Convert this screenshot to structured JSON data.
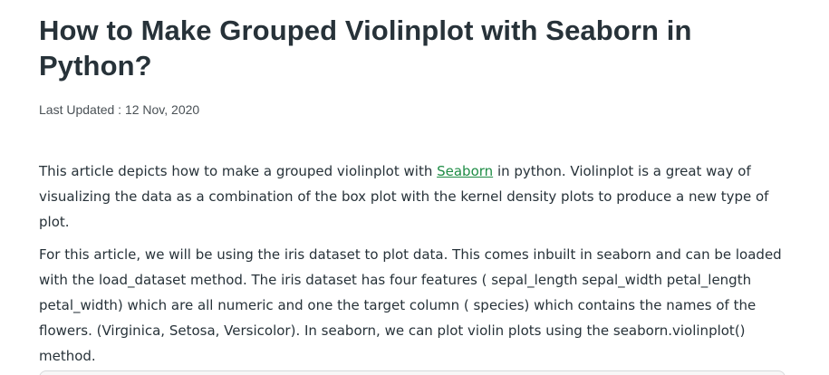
{
  "article": {
    "title": "How to Make Grouped Violinplot with Seaborn in Python?",
    "last_updated_label": "Last Updated : ",
    "last_updated_date": "12 Nov, 2020",
    "p1": {
      "before_link": "This article depicts how to make a grouped violinplot with ",
      "link_text": "Seaborn",
      "after_link": " in python. Violinplot is a great way of visualizing the data as a combination of the box plot with the kernel density plots to produce a new type of plot."
    },
    "p2": "For this article, we will be using the iris dataset to plot data. This comes inbuilt in seaborn and can be loaded with the load_dataset method. The iris dataset has four features ( sepal_length  sepal_width  petal_length  petal_width) which are all numeric and one the target column ( species) which contains the names of the flowers. (Virginica, Setosa, Versicolor). In seaborn, we can plot violin plots using the seaborn.violinplot() method."
  },
  "colors": {
    "text": "#273239",
    "link": "#1e8c45",
    "meta": "#4a5156"
  }
}
